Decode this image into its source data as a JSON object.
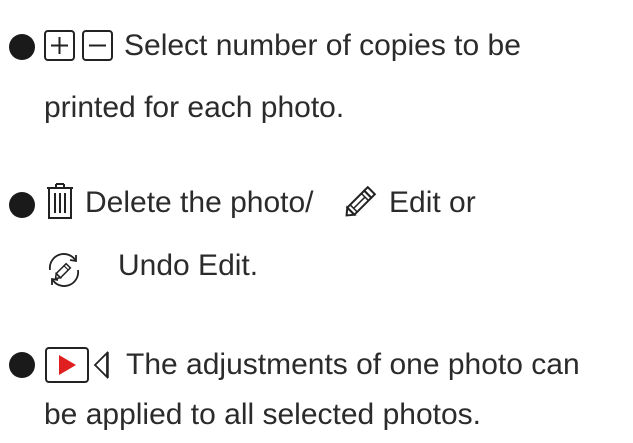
{
  "items": [
    {
      "line1": "Select number of copies to be",
      "line2": "printed for each photo.",
      "icons": [
        "plus-icon",
        "minus-icon"
      ]
    },
    {
      "line1_a": "Delete the photo/",
      "line1_b": "Edit or",
      "line2": "Undo Edit.",
      "icons": [
        "trash-icon",
        "pencil-icon",
        "undo-edit-icon"
      ]
    },
    {
      "line1": "The adjustments of one photo can",
      "line2": "be applied to all selected photos.",
      "icons": [
        "play-icon",
        "apply-all-icon"
      ],
      "accent_color": "#e02020"
    }
  ]
}
